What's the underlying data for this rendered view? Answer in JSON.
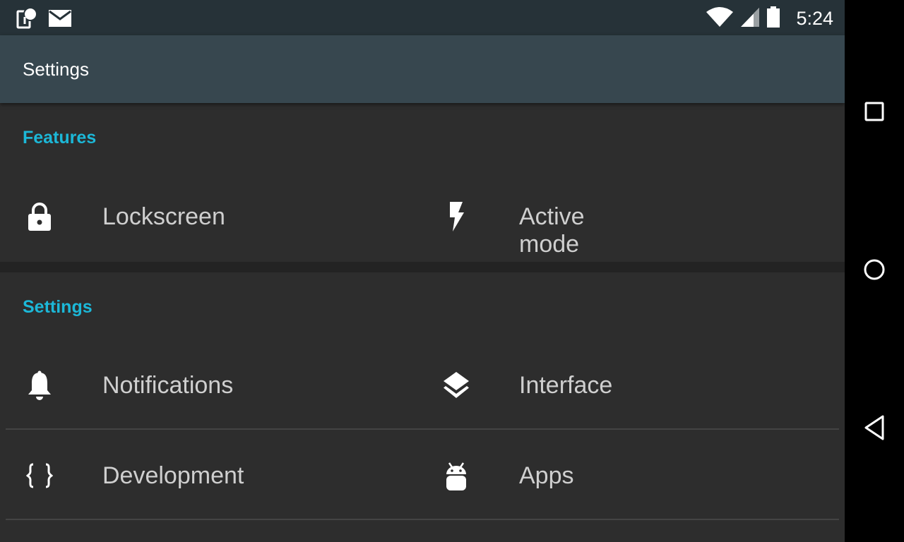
{
  "status_bar": {
    "time": "5:24",
    "left_icons": [
      "pushbullet-icon",
      "mail-icon"
    ],
    "right_icons": [
      "wifi-icon",
      "signal-icon",
      "battery-icon"
    ]
  },
  "app_bar": {
    "title": "Settings"
  },
  "sections": [
    {
      "header": "Features",
      "items": [
        {
          "label": "Lockscreen",
          "icon": "lock-icon"
        },
        {
          "label": "Active mode",
          "icon": "flash-icon"
        }
      ]
    },
    {
      "header": "Settings",
      "items": [
        {
          "label": "Notifications",
          "icon": "bell-icon"
        },
        {
          "label": "Interface",
          "icon": "layers-icon"
        },
        {
          "label": "Development",
          "icon": "braces-icon"
        },
        {
          "label": "Apps",
          "icon": "android-icon"
        }
      ]
    }
  ],
  "nav_bar": {
    "buttons": [
      "recents-icon",
      "home-icon",
      "back-icon"
    ]
  },
  "colors": {
    "status_bar": "#263238",
    "app_bar": "#37474f",
    "background": "#2d2d2d",
    "accent": "#1cb8d8",
    "text": "#cfcfcf"
  }
}
